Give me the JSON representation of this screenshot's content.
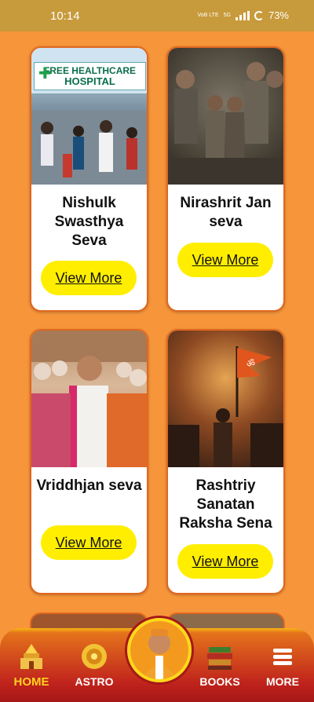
{
  "status": {
    "time": "10:14",
    "battery": "73%",
    "net1": "VoB LTE",
    "net2": "5G"
  },
  "cards": [
    {
      "title": "Nishulk Swasthya Seva",
      "button": "View More",
      "sign_line1": "FREE HEALTHCARE",
      "sign_line2": "HOSPITAL"
    },
    {
      "title": "Nirashrit Jan seva",
      "button": "View More"
    },
    {
      "title": "Vriddhjan seva",
      "button": "View More"
    },
    {
      "title": "Rashtriy Sanatan Raksha Sena",
      "button": "View More"
    }
  ],
  "nav": {
    "home": "HOME",
    "astro": "ASTRO",
    "books": "BOOKS",
    "more": "MORE"
  },
  "colors": {
    "background": "#f6953a",
    "accent": "#ffee00",
    "nav": "#c0231c",
    "active": "#ffd21f"
  }
}
